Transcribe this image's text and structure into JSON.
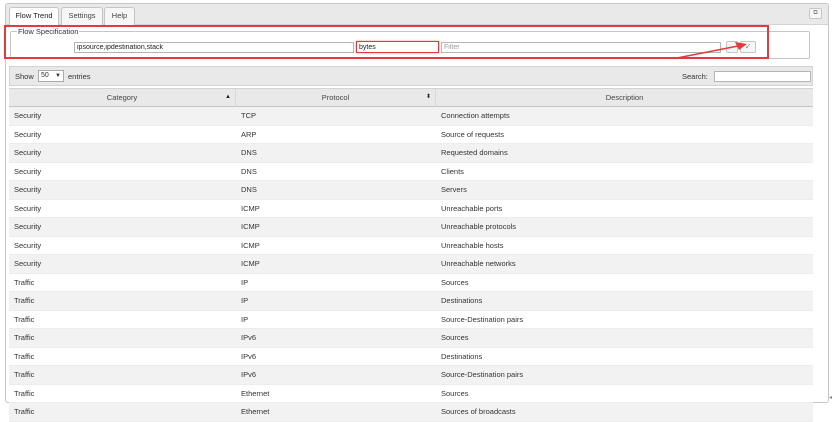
{
  "tabs": [
    {
      "label": "Flow Trend",
      "active": true
    },
    {
      "label": "Settings",
      "active": false
    },
    {
      "label": "Help",
      "active": false
    }
  ],
  "window_button_icon": "restore-icon",
  "flow_spec": {
    "legend": "Flow Specification",
    "keys_value": "ipsource,ipdestination,stack",
    "value_field": "bytes",
    "filter_placeholder": "Filter",
    "submit_icon": "checkmark-icon"
  },
  "annotation_color": "#e23b3b",
  "table_controls": {
    "show_label": "Show",
    "entries_value": "50",
    "entries_label": "entries",
    "search_label": "Search:",
    "search_value": ""
  },
  "columns": [
    {
      "label": "Category",
      "sort": "asc-icon"
    },
    {
      "label": "Protocol",
      "sort": "both-icon"
    },
    {
      "label": "Description",
      "sort": ""
    }
  ],
  "rows": [
    [
      "Security",
      "TCP",
      "Connection attempts"
    ],
    [
      "Security",
      "ARP",
      "Source of requests"
    ],
    [
      "Security",
      "DNS",
      "Requested domains"
    ],
    [
      "Security",
      "DNS",
      "Clients"
    ],
    [
      "Security",
      "DNS",
      "Servers"
    ],
    [
      "Security",
      "ICMP",
      "Unreachable ports"
    ],
    [
      "Security",
      "ICMP",
      "Unreachable protocols"
    ],
    [
      "Security",
      "ICMP",
      "Unreachable hosts"
    ],
    [
      "Security",
      "ICMP",
      "Unreachable networks"
    ],
    [
      "Traffic",
      "IP",
      "Sources"
    ],
    [
      "Traffic",
      "IP",
      "Destinations"
    ],
    [
      "Traffic",
      "IP",
      "Source-Destination pairs"
    ],
    [
      "Traffic",
      "IPv6",
      "Sources"
    ],
    [
      "Traffic",
      "IPv6",
      "Destinations"
    ],
    [
      "Traffic",
      "IPv6",
      "Source-Destination pairs"
    ],
    [
      "Traffic",
      "Ethernet",
      "Sources"
    ],
    [
      "Traffic",
      "Ethernet",
      "Sources of broadcasts"
    ]
  ]
}
